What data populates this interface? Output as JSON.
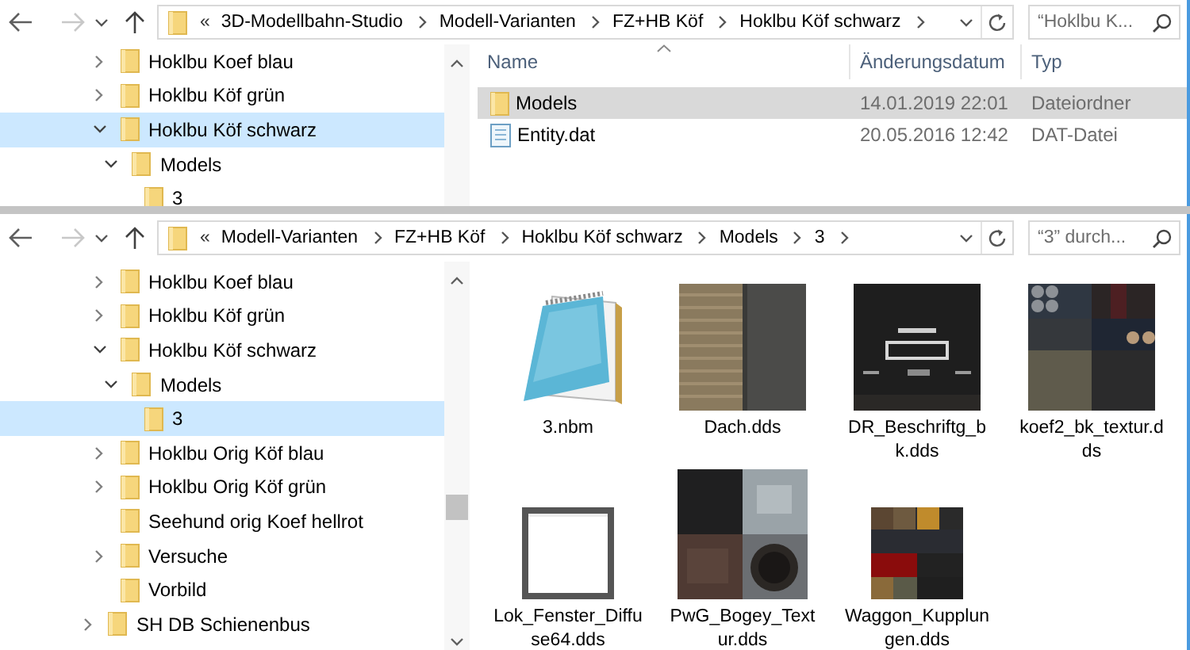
{
  "windows": [
    {
      "nav": {
        "back_disabled": false,
        "forward_disabled": true
      },
      "address": {
        "overflow": "«",
        "crumbs": [
          "3D-Modellbahn-Studio",
          "Modell-Varianten",
          "FZ+HB Köf",
          "Hoklbu Köf schwarz"
        ]
      },
      "search": {
        "placeholder": "“Hoklbu K..."
      },
      "tree": [
        {
          "children": [
            {
              "label": "Hoklbu Koef blau",
              "expandable": true,
              "expanded": false,
              "selected": false
            },
            {
              "label": "Hoklbu Köf grün",
              "expandable": true,
              "expanded": false,
              "selected": false
            },
            {
              "label": "Hoklbu Köf schwarz",
              "expandable": true,
              "expanded": true,
              "selected": true,
              "children": [
                {
                  "label": "Models",
                  "expandable": true,
                  "expanded": true,
                  "selected": false,
                  "children": [
                    {
                      "label": "3",
                      "expandable": false,
                      "selected": false
                    }
                  ]
                }
              ]
            }
          ]
        }
      ],
      "view": {
        "kind": "details",
        "columns": [
          {
            "label": "Name",
            "sorted": true
          },
          {
            "label": "Änderungsdatum",
            "sorted": false
          },
          {
            "label": "Typ",
            "sorted": false
          }
        ],
        "rows": [
          {
            "kind": "folder",
            "name": "Models",
            "date": "14.01.2019 22:01",
            "type": "Dateiordner",
            "selected": true
          },
          {
            "kind": "file",
            "name": "Entity.dat",
            "date": "20.05.2016 12:42",
            "type": "DAT-Datei",
            "selected": false
          }
        ]
      }
    },
    {
      "nav": {
        "back_disabled": false,
        "forward_disabled": true
      },
      "address": {
        "overflow": "«",
        "crumbs": [
          "Modell-Varianten",
          "FZ+HB Köf",
          "Hoklbu Köf schwarz",
          "Models",
          "3"
        ]
      },
      "search": {
        "placeholder": "“3” durch..."
      },
      "tree": [
        {
          "children": [
            {
              "label": "Hoklbu Koef blau",
              "expandable": true,
              "expanded": false,
              "selected": false
            },
            {
              "label": "Hoklbu Köf grün",
              "expandable": true,
              "expanded": false,
              "selected": false
            },
            {
              "label": "Hoklbu Köf schwarz",
              "expandable": true,
              "expanded": true,
              "selected": false,
              "children": [
                {
                  "label": "Models",
                  "expandable": true,
                  "expanded": true,
                  "selected": false,
                  "children": [
                    {
                      "label": "3",
                      "expandable": false,
                      "selected": true
                    }
                  ]
                }
              ]
            },
            {
              "label": "Hoklbu Orig Köf blau",
              "expandable": true,
              "expanded": false,
              "selected": false
            },
            {
              "label": "Hoklbu Orig Köf grün",
              "expandable": true,
              "expanded": false,
              "selected": false
            },
            {
              "label": "Seehund orig Koef hellrot",
              "expandable": false,
              "selected": false
            },
            {
              "label": "Versuche",
              "expandable": true,
              "expanded": false,
              "selected": false
            },
            {
              "label": "Vorbild",
              "expandable": false,
              "selected": false
            }
          ]
        },
        {
          "label": "SH DB Schienenbus",
          "expandable": true,
          "expanded": false,
          "selected": false
        }
      ],
      "view": {
        "kind": "icons",
        "items": [
          {
            "kind": "document",
            "name": "3.nbm"
          },
          {
            "kind": "picture",
            "name": "Dach.dds"
          },
          {
            "kind": "picture",
            "name": "DR_Beschriftg_bk.dds"
          },
          {
            "kind": "picture",
            "name": "koef2_bk_textur.dds"
          },
          {
            "kind": "picture",
            "name": "Lok_Fenster_Diffuse64.dds"
          },
          {
            "kind": "picture",
            "name": "PwG_Bogey_Textur.dds"
          },
          {
            "kind": "picture",
            "name": "Waggon_Kupplungen.dds"
          }
        ]
      }
    }
  ]
}
